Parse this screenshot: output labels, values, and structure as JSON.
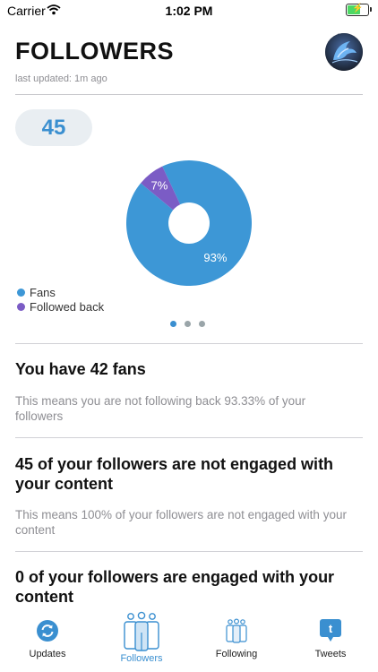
{
  "status_bar": {
    "carrier": "Carrier",
    "time": "1:02 PM"
  },
  "header": {
    "title": "FOLLOWERS",
    "last_updated": "last updated: 1m ago"
  },
  "summary": {
    "count": "45"
  },
  "donut": {
    "slices": [
      {
        "name": "Fans",
        "percent": 93,
        "label": "93%",
        "color": "#3d97d6"
      },
      {
        "name": "Followed back",
        "percent": 7,
        "label": "7%",
        "color": "#7b5cc5"
      }
    ]
  },
  "legend": {
    "items": [
      {
        "label": "Fans"
      },
      {
        "label": "Followed back"
      }
    ]
  },
  "pager": {
    "count": 3,
    "active": 0,
    "active_color": "#3a8fd0",
    "inactive_color": "#9aa5a9"
  },
  "sections": [
    {
      "heading": "You have 42 fans",
      "body": "This means you are not following back 93.33% of your followers"
    },
    {
      "heading": "45 of your followers are not engaged with your content",
      "body": "This means 100% of your followers are not engaged with your content"
    },
    {
      "heading": "0 of your followers are engaged with your content"
    }
  ],
  "tabbar": {
    "tabs": [
      {
        "label": "Updates",
        "icon": "refresh-icon",
        "active": false
      },
      {
        "label": "Followers",
        "icon": "followers-icon",
        "active": true
      },
      {
        "label": "Following",
        "icon": "following-icon",
        "active": false
      },
      {
        "label": "Tweets",
        "icon": "tweets-icon",
        "active": false
      }
    ],
    "accent_color": "#3a8fd0"
  }
}
